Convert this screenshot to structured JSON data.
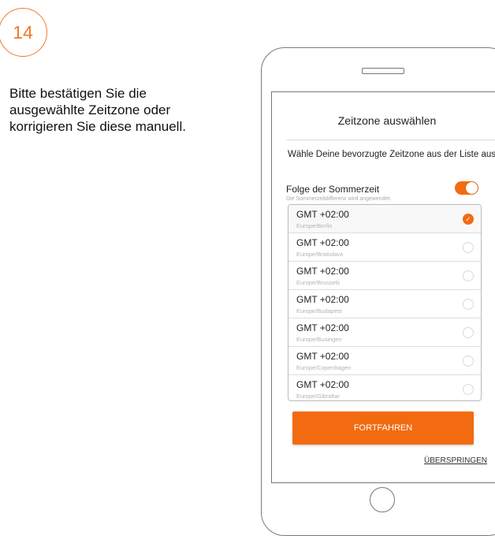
{
  "step": {
    "number": "14"
  },
  "instruction": "Bitte bestätigen Sie die ausgewählte Zeitzone oder korrigieren Sie diese manuell.",
  "screen": {
    "title": "Zeitzone auswählen",
    "prompt": "Wähle Deine bevorzugte Zeitzone aus der Liste aus",
    "dst": {
      "label": "Folge der Sommerzeit",
      "sublabel": "Die Sommerzeitdifferenz wird angewendet.",
      "enabled": true
    },
    "timezones": [
      {
        "offset": "GMT +02:00",
        "city": "Europe/Berlin",
        "selected": true
      },
      {
        "offset": "GMT +02:00",
        "city": "Europe/Bratislava",
        "selected": false
      },
      {
        "offset": "GMT +02:00",
        "city": "Europe/Brussels",
        "selected": false
      },
      {
        "offset": "GMT +02:00",
        "city": "Europe/Budapest",
        "selected": false
      },
      {
        "offset": "GMT +02:00",
        "city": "Europe/Busingen",
        "selected": false
      },
      {
        "offset": "GMT +02:00",
        "city": "Europe/Copenhagen",
        "selected": false
      },
      {
        "offset": "GMT +02:00",
        "city": "Europe/Gibraltar",
        "selected": false
      }
    ],
    "continue_label": "FORTFAHREN",
    "skip_label": "ÜBERSPRINGEN"
  },
  "colors": {
    "accent": "#f36b10",
    "badge": "#f07a2a"
  },
  "icons": {
    "selected": "check-icon"
  }
}
